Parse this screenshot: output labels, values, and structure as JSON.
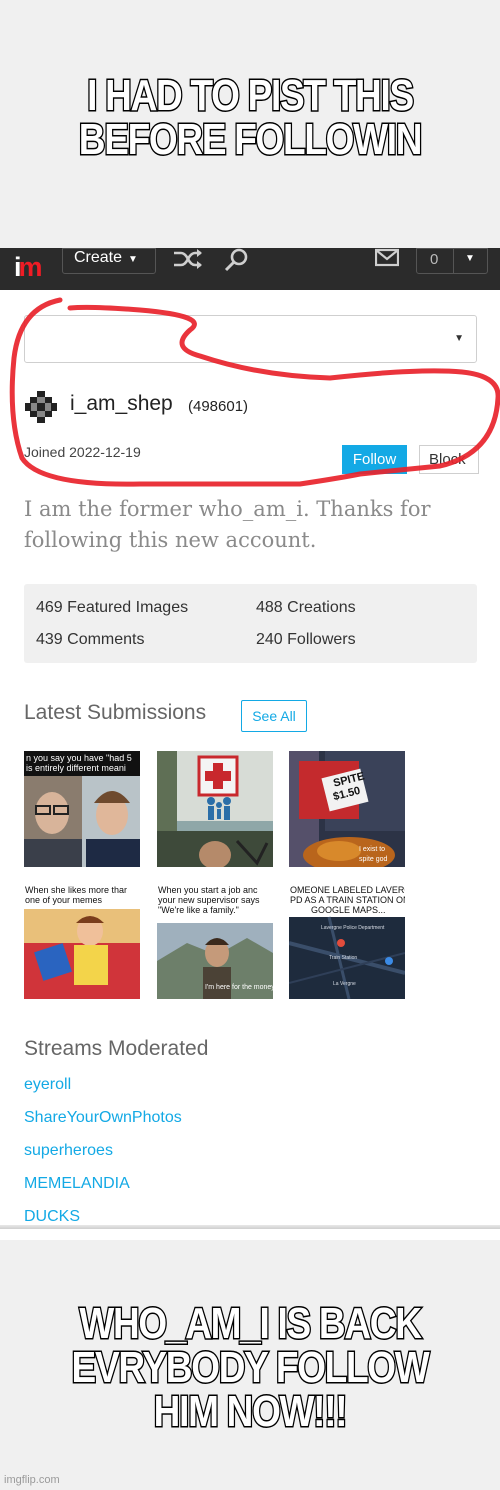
{
  "meme": {
    "top_caption": "I HAD TO PIST THIS BEFORE FOLLOWIN",
    "bottom_caption": "WHO_AM_I IS BACK EVRYBODY FOLLOW HIM NOW!!!",
    "watermark": "imgflip.com"
  },
  "navbar": {
    "logo_i": "i",
    "logo_m": "m",
    "create_label": "Create",
    "notification_count": "0",
    "icons": [
      "shuffle-icon",
      "search-icon",
      "mail-icon",
      "chevron-down-icon"
    ]
  },
  "profile": {
    "username": "i_am_shep",
    "user_id": "(498601)",
    "joined": "Joined 2022-12-19",
    "follow_label": "Follow",
    "block_label": "Block",
    "bio": "I am the former who_am_i. Thanks for following this new account."
  },
  "stats": {
    "featured": "469 Featured Images",
    "creations": "488 Creations",
    "comments": "439 Comments",
    "followers": "240 Followers"
  },
  "latest": {
    "title": "Latest Submissions",
    "see_all_label": "See All",
    "thumbs": [
      {
        "caption": "n you say you have \"had 5",
        "caption2": "is entirely different meani"
      },
      {
        "caption": "",
        "caption2": ""
      },
      {
        "caption": "SPITE",
        "caption2": "$1.50"
      },
      {
        "caption": "When she likes more thar",
        "caption2": "one of your memes"
      },
      {
        "caption": "When you start a job anc",
        "caption2": "your new supervisor says"
      },
      {
        "caption": "OMEONE LABELED LAVERG",
        "caption2": "PD AS A TRAIN STATION ON"
      }
    ],
    "extra_text": {
      "t3_small": "I exist to spite god",
      "t5_line3": "\"We're like a family.\"",
      "t5_sub": "I'm here for the money.",
      "t6_line3": "GOOGLE MAPS...",
      "t6_map1": "Lavergne Police Department",
      "t6_map2": "Train Station",
      "t6_map3": "La Vergne"
    }
  },
  "streams": {
    "title": "Streams Moderated",
    "items": [
      "eyeroll",
      "ShareYourOwnPhotos",
      "superheroes",
      "MEMELANDIA",
      "DUCKS"
    ]
  },
  "colors": {
    "accent": "#13a9e5",
    "annotation_red": "#e8232b",
    "navbar": "#2b2b2b"
  }
}
